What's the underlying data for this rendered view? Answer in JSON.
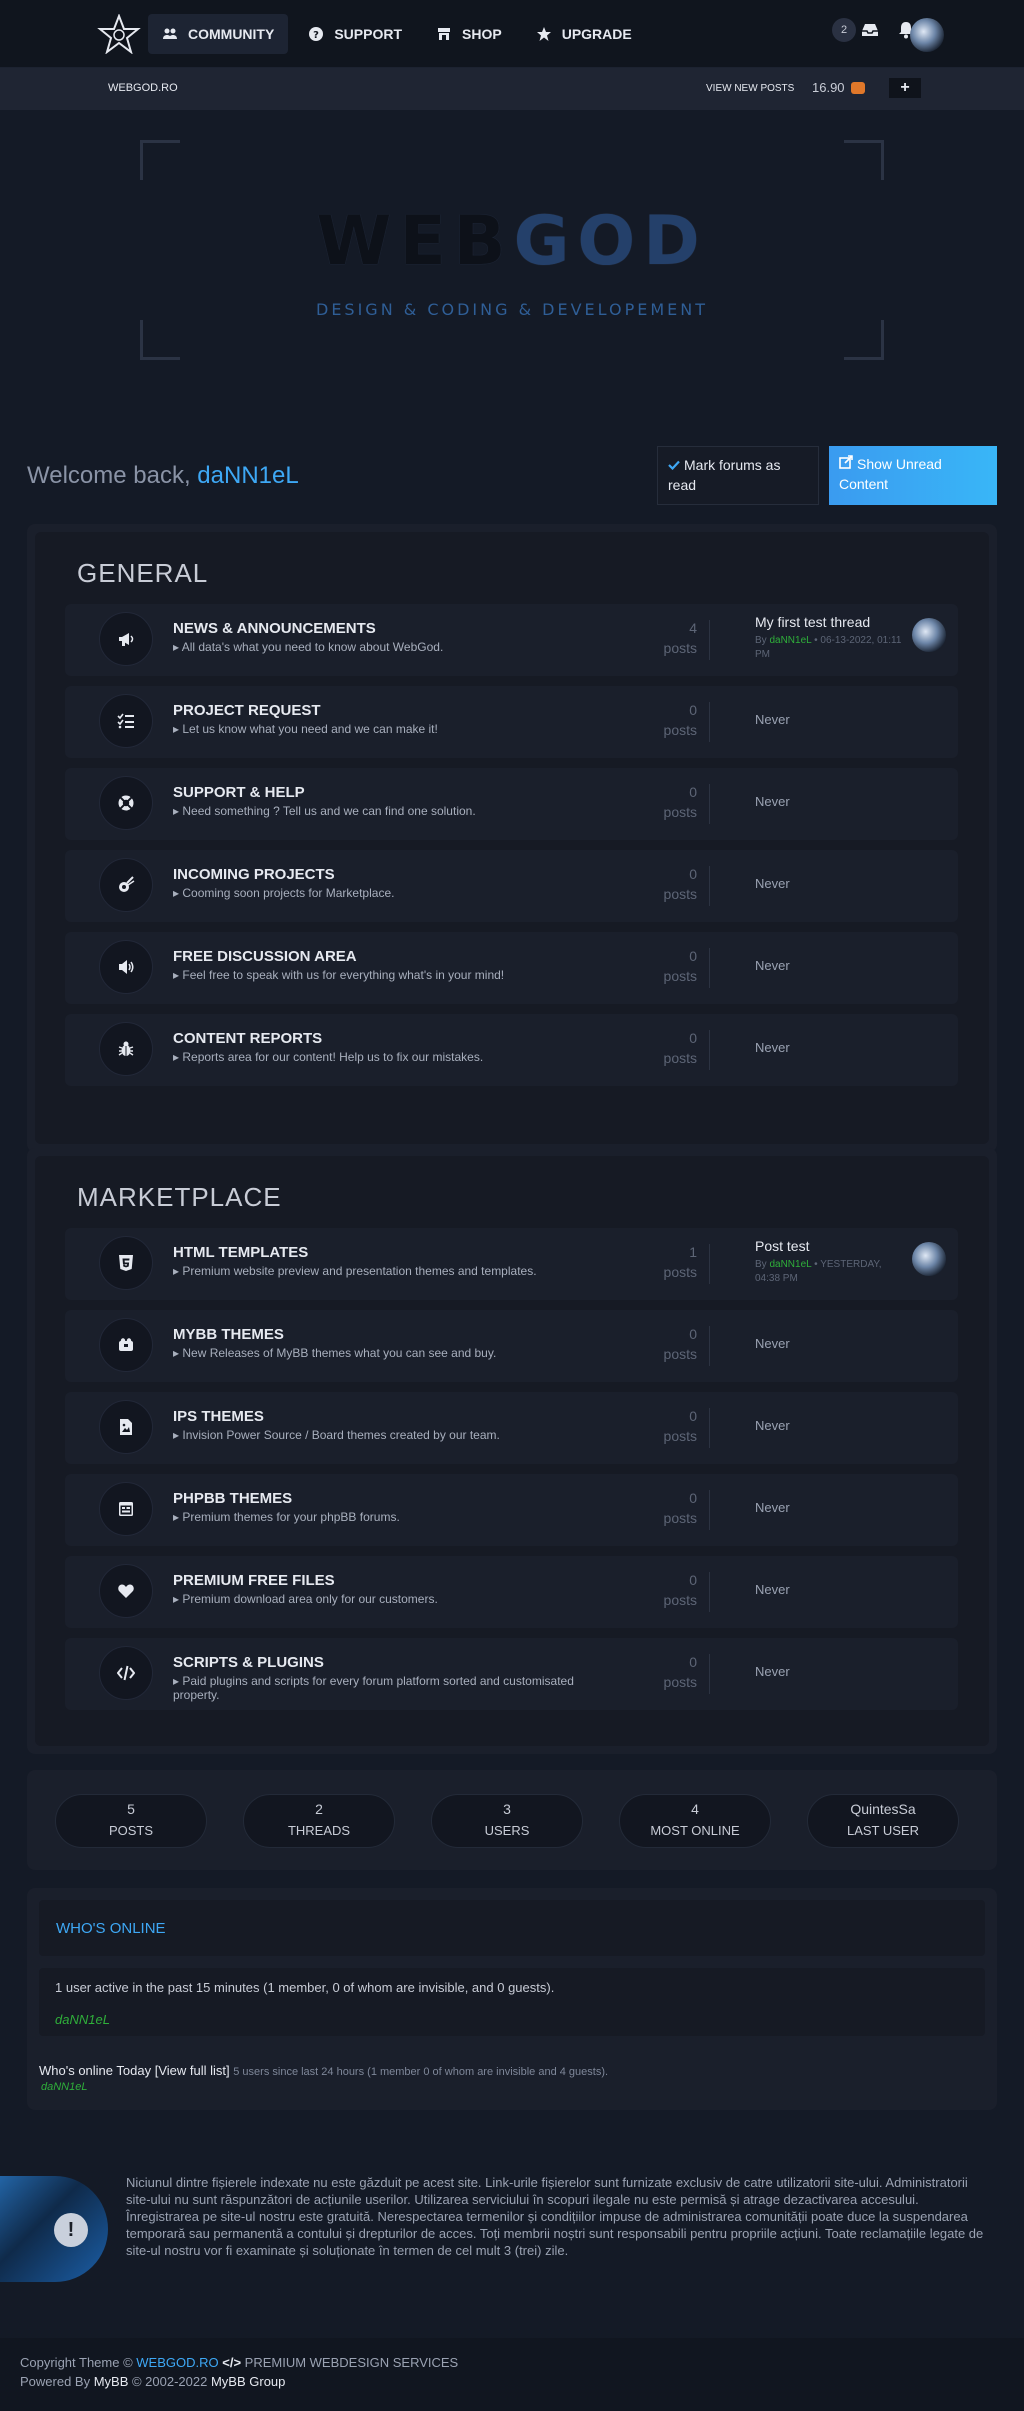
{
  "nav": {
    "items": [
      {
        "label": "COMMUNITY",
        "icon": "users-icon",
        "active": true
      },
      {
        "label": "SUPPORT",
        "icon": "question-icon",
        "active": false
      },
      {
        "label": "SHOP",
        "icon": "store-icon",
        "active": false
      },
      {
        "label": "UPGRADE",
        "icon": "star-icon",
        "active": false
      }
    ],
    "notification_count": "2"
  },
  "subbar": {
    "breadcrumb": "WEBGOD.RO",
    "view_new_posts": "VIEW NEW POSTS",
    "credits": "16.90",
    "plus": "+"
  },
  "hero": {
    "title_a": "WEB",
    "title_b": "GOD",
    "subtitle": "DESIGN & CODING & DEVELOPEMENT"
  },
  "welcome": {
    "prefix": "Welcome back, ",
    "username": "daNN1eL",
    "mark_read": "Mark forums as read",
    "show_unread": "Show Unread Content"
  },
  "general": {
    "title": "GENERAL",
    "forums": [
      {
        "name": "NEWS & ANNOUNCEMENTS",
        "desc": "All data's what you need to know about WebGod.",
        "count": "4",
        "unit": "posts",
        "icon": "megaphone-icon",
        "last_thread": "My first test thread",
        "last_by": "By ",
        "last_user": "daNN1eL",
        "last_date": " • 06-13-2022, 01:11 PM"
      },
      {
        "name": "PROJECT REQUEST",
        "desc": "Let us know what you need and we can make it!",
        "count": "0",
        "unit": "posts",
        "icon": "list-check-icon",
        "last": "Never"
      },
      {
        "name": "SUPPORT & HELP",
        "desc": "Need something ? Tell us and we can find one solution.",
        "count": "0",
        "unit": "posts",
        "icon": "lifebuoy-icon",
        "last": "Never"
      },
      {
        "name": "INCOMING PROJECTS",
        "desc": "Cooming soon projects for Marketplace.",
        "count": "0",
        "unit": "posts",
        "icon": "comet-icon",
        "last": "Never"
      },
      {
        "name": "FREE DISCUSSION AREA",
        "desc": "Feel free to speak with us for everything what's in your mind!",
        "count": "0",
        "unit": "posts",
        "icon": "speaker-icon",
        "last": "Never"
      },
      {
        "name": "CONTENT REPORTS",
        "desc": "Reports area for our content! Help us to fix our mistakes.",
        "count": "0",
        "unit": "posts",
        "icon": "bug-icon",
        "last": "Never"
      }
    ]
  },
  "marketplace": {
    "title": "MARKETPLACE",
    "forums": [
      {
        "name": "HTML TEMPLATES",
        "desc": "Premium website preview and presentation themes and templates.",
        "count": "1",
        "unit": "posts",
        "icon": "html5-icon",
        "last_thread": "Post test",
        "last_by": "By ",
        "last_user": "daNN1eL",
        "last_date": " • YESTERDAY, 04:38 PM"
      },
      {
        "name": "MYBB THEMES",
        "desc": "New Releases of MyBB themes what you can see and buy.",
        "count": "0",
        "unit": "posts",
        "icon": "puzzle-icon",
        "last": "Never"
      },
      {
        "name": "IPS THEMES",
        "desc": "Invision Power Source / Board themes created by our team.",
        "count": "0",
        "unit": "posts",
        "icon": "file-image-icon",
        "last": "Never"
      },
      {
        "name": "PHPBB THEMES",
        "desc": "Premium themes for your phpBB forums.",
        "count": "0",
        "unit": "posts",
        "icon": "window-icon",
        "last": "Never"
      },
      {
        "name": "PREMIUM FREE FILES",
        "desc": "Premium download area only for our customers.",
        "count": "0",
        "unit": "posts",
        "icon": "heart-icon",
        "last": "Never"
      },
      {
        "name": "SCRIPTS & PLUGINS",
        "desc": "Paid plugins and scripts for every forum platform sorted and customisated property.",
        "count": "0",
        "unit": "posts",
        "icon": "code-icon",
        "last": "Never"
      }
    ]
  },
  "stats": [
    {
      "value": "5",
      "label": "POSTS"
    },
    {
      "value": "2",
      "label": "THREADS"
    },
    {
      "value": "3",
      "label": "USERS"
    },
    {
      "value": "4",
      "label": "MOST ONLINE"
    },
    {
      "value": "QuintesSa",
      "label": "LAST USER"
    }
  ],
  "online": {
    "title": "WHO'S ONLINE",
    "summary": "1 user active in the past 15 minutes (1 member, 0 of whom are invisible, and 0 guests).",
    "user": "daNN1eL",
    "today_label": "Who's online Today",
    "full_list": "View full list",
    "today_summary": "5 users since last 24 hours (1 member 0 of whom are invisible and 4 guests).",
    "today_user": "daNN1eL"
  },
  "notice": {
    "text": "Niciunul dintre fișierele indexate nu este găzduit pe acest site. Link-urile fișierelor sunt furnizate exclusiv de catre utilizatorii site-ului. Administratorii site-ului nu sunt răspunzători de acțiunile userilor. Utilizarea serviciului în scopuri ilegale nu este permisă și atrage dezactivarea accesului. Înregistrarea pe site-ul nostru este gratuită. Nerespectarea termenilor și condițiilor impuse de administrarea comunității poate duce la suspendarea temporară sau permanentă a contului și drepturilor de acces. Toți membrii noștri sunt responsabili pentru propriile acțiuni. Toate reclamațiile legate de site-ul nostru vor fi examinate și soluționate în termen de cel mult 3 (trei) zile.",
    "icon_glyph": "!"
  },
  "footer": {
    "copyright": "Copyright Theme © ",
    "brand": "WEBGOD.RO",
    "code_glyph": "</>",
    "services": " PREMIUM WEBDESIGN SERVICES",
    "powered_prefix": "Powered By ",
    "mybb": "MyBB",
    "years": " © 2002-2022 ",
    "group": "MyBB Group"
  },
  "colors": {
    "accent": "#3ea8f5",
    "online_user": "#2faf3a",
    "background": "#141a26"
  }
}
